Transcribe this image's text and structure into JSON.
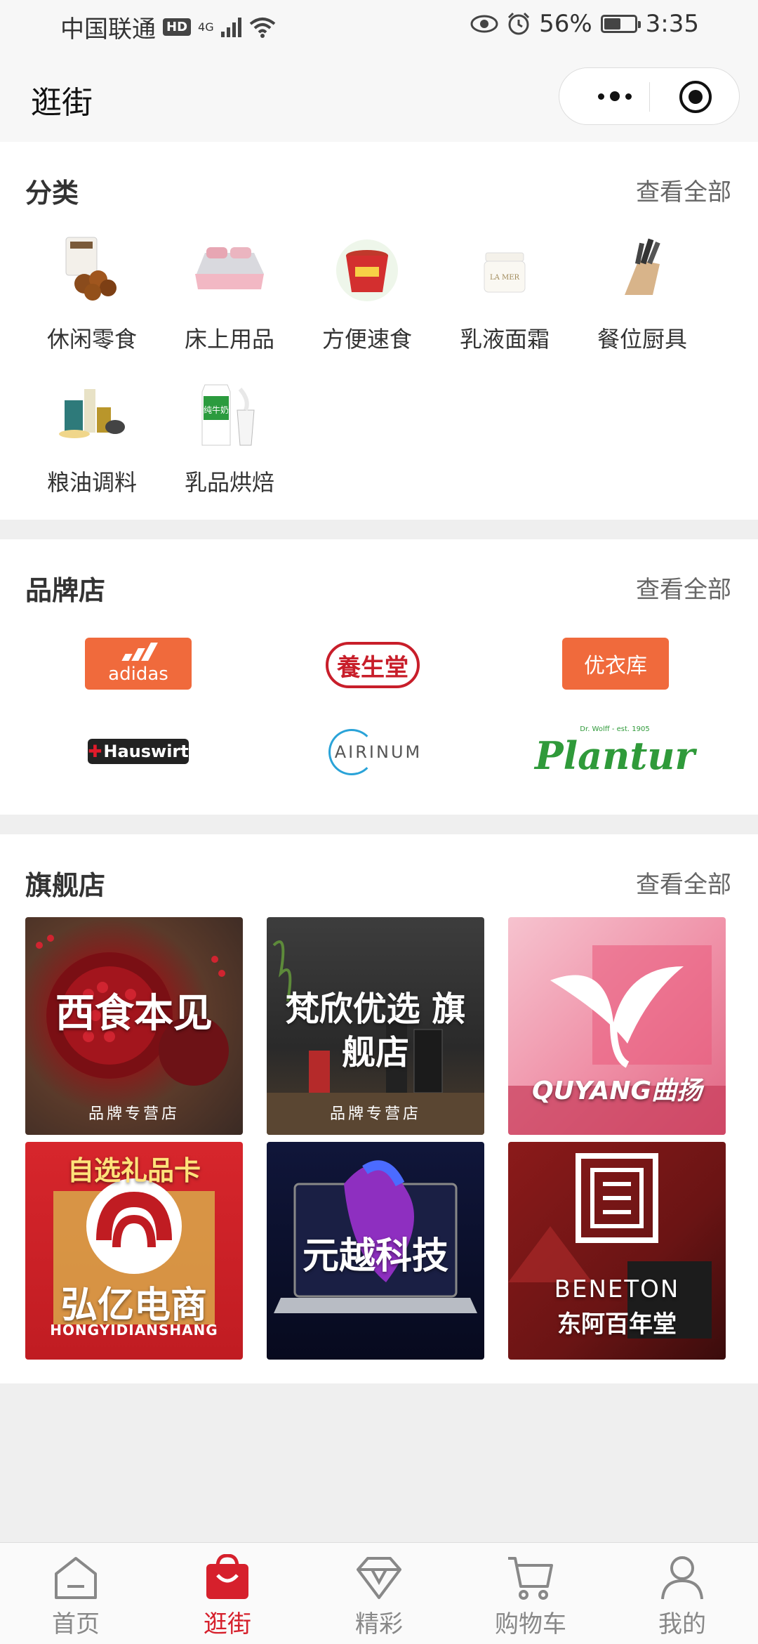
{
  "status_bar": {
    "carrier": "中国联通",
    "hd": "HD",
    "net": "4G",
    "battery": "56%",
    "battery_level": 0.56,
    "time": "3:35"
  },
  "nav": {
    "title": "逛街"
  },
  "categories": {
    "title": "分类",
    "more": "查看全部",
    "items": [
      {
        "label": "休闲零食"
      },
      {
        "label": "床上用品"
      },
      {
        "label": "方便速食"
      },
      {
        "label": "乳液面霜"
      },
      {
        "label": "餐位厨具"
      },
      {
        "label": "粮油调料"
      },
      {
        "label": "乳品烘焙"
      }
    ]
  },
  "brands": {
    "title": "品牌店",
    "more": "查看全部",
    "items": [
      {
        "name": "adidas"
      },
      {
        "name": "養生堂"
      },
      {
        "name": "优衣库"
      },
      {
        "name": "Hauswirt"
      },
      {
        "name": "AIRINUM"
      },
      {
        "name": "Plantur",
        "tagline": "Dr. Wolff - est. 1905"
      }
    ]
  },
  "flagships": {
    "title": "旗舰店",
    "more": "查看全部",
    "items": [
      {
        "name": "西食本见",
        "sub": "品牌专营店"
      },
      {
        "name": "梵欣优选 旗舰店",
        "sub": "品牌专营店"
      },
      {
        "name": "QUYANG曲扬"
      },
      {
        "name": "弘亿电商",
        "banner": "自选礼品卡",
        "latin": "HONGYIDIANSHANG"
      },
      {
        "name": "元越科技"
      },
      {
        "name": "东阿百年堂",
        "latin": "BENETON"
      }
    ]
  },
  "tabbar": {
    "items": [
      {
        "label": "首页",
        "icon": "home-icon"
      },
      {
        "label": "逛街",
        "icon": "shopping-bag-icon",
        "active": true
      },
      {
        "label": "精彩",
        "icon": "diamond-icon"
      },
      {
        "label": "购物车",
        "icon": "cart-icon"
      },
      {
        "label": "我的",
        "icon": "user-icon"
      }
    ]
  },
  "colors": {
    "accent": "#d6202c",
    "brand_orange": "#f06a3c"
  }
}
